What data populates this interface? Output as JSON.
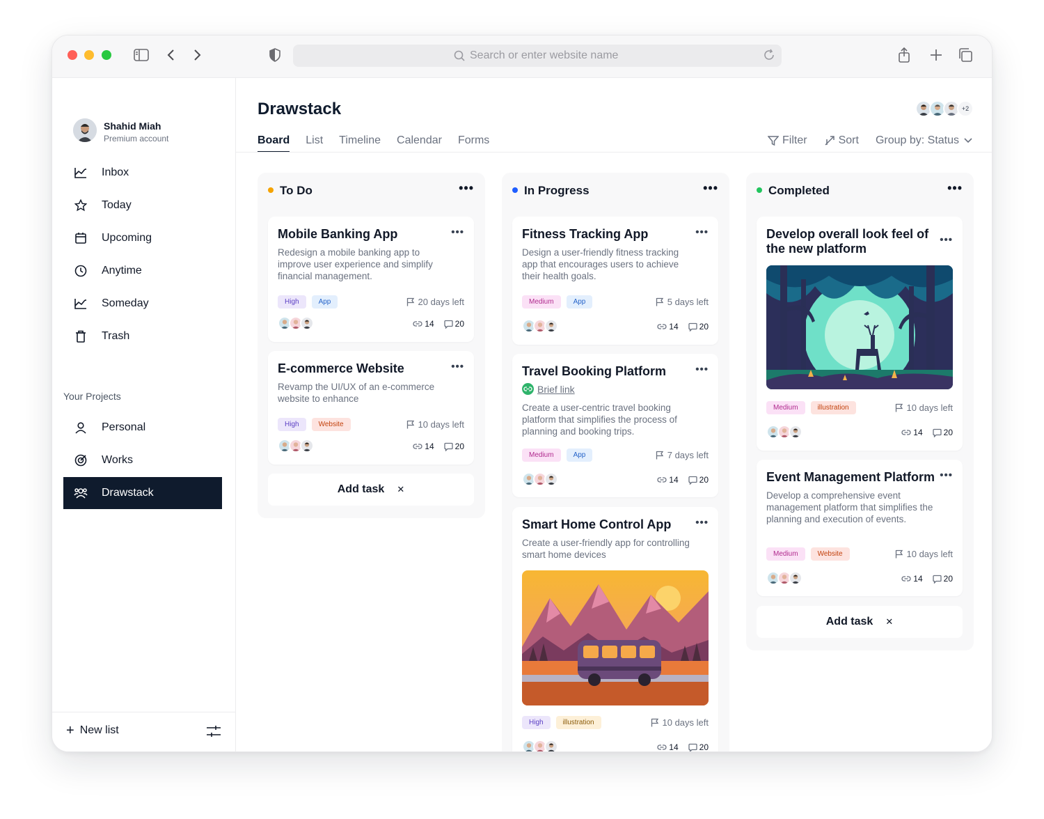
{
  "browser": {
    "url_placeholder": "Search or enter website name"
  },
  "sidebar": {
    "profile": {
      "name": "Shahid Miah",
      "subtitle": "Premium account"
    },
    "nav": [
      {
        "label": "Inbox",
        "icon": "inbox-icon"
      },
      {
        "label": "Today",
        "icon": "star-icon"
      },
      {
        "label": "Upcoming",
        "icon": "calendar-icon"
      },
      {
        "label": "Anytime",
        "icon": "clock-icon"
      },
      {
        "label": "Someday",
        "icon": "tray-icon"
      },
      {
        "label": "Trash",
        "icon": "trash-icon"
      }
    ],
    "projects_title": "Your Projects",
    "projects": [
      {
        "label": "Personal",
        "icon": "user-icon"
      },
      {
        "label": "Works",
        "icon": "target-icon"
      },
      {
        "label": "Drawstack",
        "icon": "team-icon",
        "active": true
      }
    ],
    "new_list": "New list"
  },
  "main": {
    "title": "Drawstack",
    "team_more": "+2",
    "tabs": [
      "Board",
      "List",
      "Timeline",
      "Calendar",
      "Forms"
    ],
    "active_tab": "Board",
    "toolbar": {
      "filter": "Filter",
      "sort": "Sort",
      "group_by": "Group by: Status"
    }
  },
  "colors": {
    "todo": "#f5a300",
    "in_progress": "#1f5eff",
    "completed": "#22c55e",
    "active_nav": "#0f1b2d"
  },
  "columns": [
    {
      "title": "To Do",
      "cards": [
        {
          "title": "Mobile Banking App",
          "desc": "Redesign a mobile banking app to improve user experience and simplify financial management.",
          "tags": [
            "High",
            "App"
          ],
          "days": "20 days left",
          "links": "14",
          "comments": "20"
        },
        {
          "title": "E-commerce Website",
          "desc": "Revamp the UI/UX of an e-commerce website to enhance",
          "tags": [
            "High",
            "Website"
          ],
          "days": "10 days left",
          "links": "14",
          "comments": "20"
        }
      ],
      "add_task": "Add task"
    },
    {
      "title": "In Progress",
      "cards": [
        {
          "title": "Fitness Tracking App",
          "desc": "Design a user-friendly fitness tracking app that encourages users to achieve their health goals.",
          "tags": [
            "Medium",
            "App"
          ],
          "days": "5 days left",
          "links": "14",
          "comments": "20"
        },
        {
          "title": "Travel Booking Platform",
          "brief": "Brief link",
          "desc": "Create a user-centric travel booking platform that simplifies the process of planning and booking trips.",
          "tags": [
            "Medium",
            "App"
          ],
          "days": "7 days left",
          "links": "14",
          "comments": "20"
        },
        {
          "title": "Smart Home Control App",
          "desc": "Create a user-friendly app for controlling smart home devices",
          "tags": [
            "High",
            "illustration"
          ],
          "days": "10 days left",
          "links": "14",
          "comments": "20"
        }
      ]
    },
    {
      "title": "Completed",
      "cards": [
        {
          "title": "Develop overall look feel of the new platform",
          "tags": [
            "Medium",
            "illustration"
          ],
          "days": "10 days left",
          "links": "14",
          "comments": "20"
        },
        {
          "title": "Event Management Platform",
          "desc": "Develop a comprehensive event management platform that simplifies the planning and execution of events.",
          "tags": [
            "Medium",
            "Website"
          ],
          "days": "10 days left",
          "links": "14",
          "comments": "20"
        }
      ],
      "add_task": "Add task"
    }
  ]
}
